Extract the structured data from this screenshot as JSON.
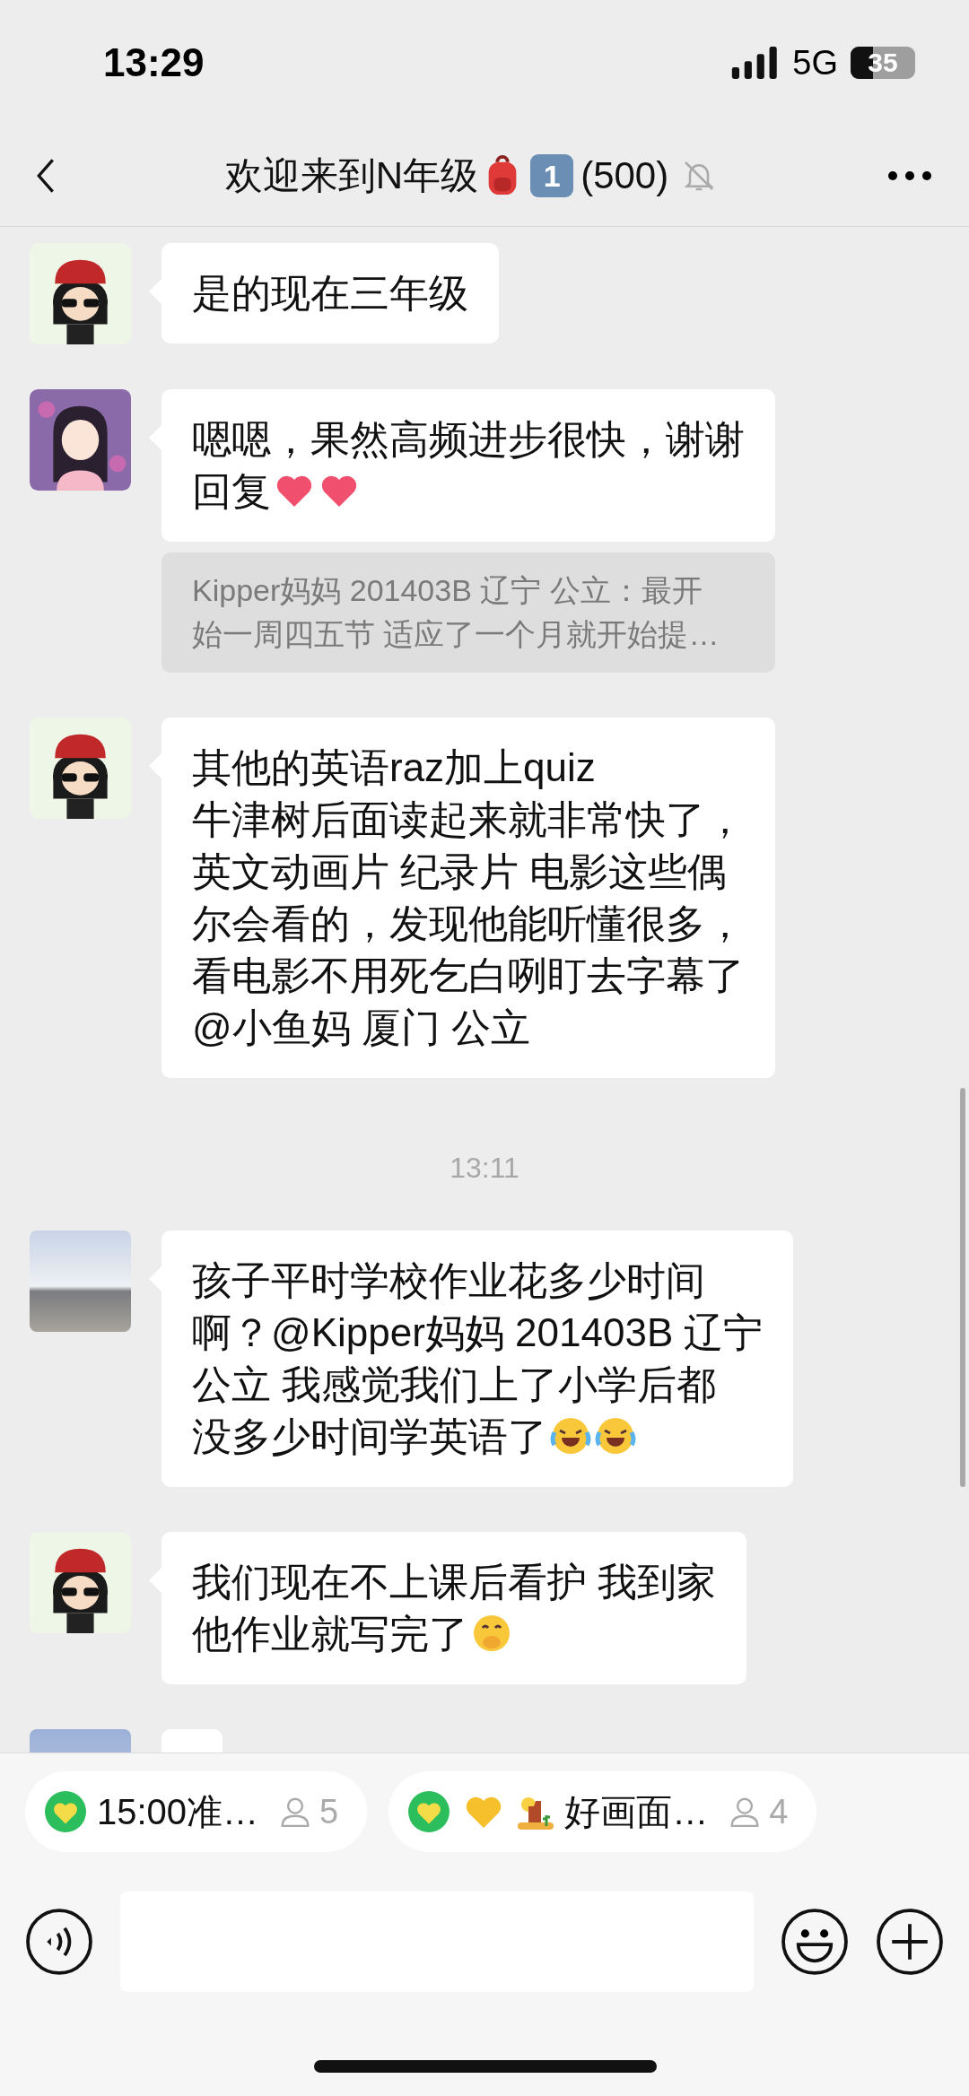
{
  "status_bar": {
    "time": "13:29",
    "network": "5G",
    "battery": "35"
  },
  "header": {
    "title_parts": [
      {
        "kind": "text",
        "text": "欢迎来到N年级"
      },
      {
        "kind": "backpack"
      },
      {
        "kind": "keycap",
        "text": "1"
      },
      {
        "kind": "text",
        "text": "(500)"
      }
    ],
    "muted": true
  },
  "chat": [
    {
      "kind": "message",
      "avatar": {
        "kind": "cartoon-hat"
      },
      "lines": [
        "是的现在三年级"
      ]
    },
    {
      "kind": "message",
      "avatar": {
        "kind": "anime"
      },
      "lines": [
        "嗯嗯，果然高频进步很快，谢谢",
        "回复"
      ],
      "icons": [
        {
          "kind": "heart"
        },
        {
          "kind": "heart"
        }
      ],
      "quote": [
        "Kipper妈妈 201403B 辽宁 公立：最开",
        "始一周四五节 适应了一个月就开始提…"
      ]
    },
    {
      "kind": "message",
      "avatar": {
        "kind": "cartoon-hat"
      },
      "lines": [
        "其他的英语raz加上quiz",
        "牛津树后面读起来就非常快了，",
        "英文动画片 纪录片 电影这些偶",
        "尔会看的，发现他能听懂很多，",
        "看电影不用死乞白咧盯去字幕了",
        "@小鱼妈 厦门 公立"
      ]
    },
    {
      "kind": "time",
      "text": "13:11"
    },
    {
      "kind": "message",
      "avatar": {
        "kind": "photo-sea"
      },
      "lines": [
        "孩子平时学校作业花多少时间",
        "啊？@Kipper妈妈 201403B 辽宁",
        "公立 我感觉我们上了小学后都",
        "没多少时间学英语了"
      ],
      "icons": [
        {
          "kind": "laugh-cry"
        },
        {
          "kind": "laugh-cry"
        }
      ]
    },
    {
      "kind": "message",
      "avatar": {
        "kind": "cartoon-hat"
      },
      "lines": [
        "我们现在不上课后看护  我到家",
        "他作业就写完了"
      ],
      "icons": [
        {
          "kind": "hand-mouth"
        }
      ]
    },
    {
      "kind": "message",
      "avatar": {
        "kind": "photo-sky"
      }
    }
  ],
  "chips": [
    {
      "title": "15:00准…",
      "count": "5"
    },
    {
      "icons": [
        {
          "kind": "yellow-heart"
        },
        {
          "kind": "desert"
        }
      ],
      "title": "好画面…",
      "count": "4"
    }
  ]
}
